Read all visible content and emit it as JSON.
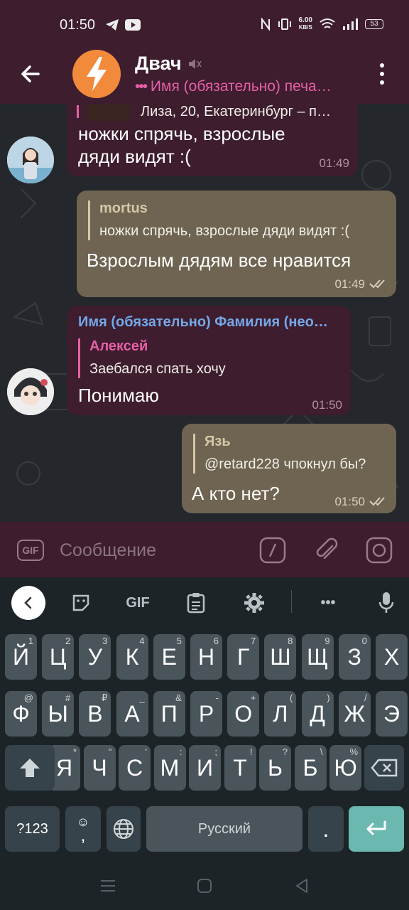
{
  "status_bar": {
    "time": "01:50",
    "speed_top": "6.00",
    "speed_unit": "KB/S",
    "battery": "53"
  },
  "header": {
    "back_label": "back",
    "title": "Двач",
    "subtitle": "Имя (обязательно) печа…",
    "typing_dots": "•••"
  },
  "messages": [
    {
      "direction": "in",
      "reply_text": "Лиза, 20, Екатеринбург – п…",
      "text_line1": "ножки спрячь, взрослые",
      "text_line2": "дяди видят :(",
      "time": "01:49"
    },
    {
      "direction": "out",
      "reply_name": "mortus",
      "reply_text": "ножки спрячь, взрослые дяди видят :(",
      "text": "Взрослым дядям все нравится",
      "time": "01:49"
    },
    {
      "direction": "in",
      "sender": "Имя (обязательно) Фамилия (нео…",
      "reply_name": "Алексей",
      "reply_text": "Заебался спать хочу",
      "text": "Понимаю",
      "time": "01:50"
    },
    {
      "direction": "out",
      "reply_name": "Язь",
      "reply_text": "@retard228 чпокнул бы?",
      "text": "А кто нет?",
      "time": "01:50"
    }
  ],
  "input": {
    "gif_label": "GIF",
    "placeholder": "Сообщение"
  },
  "keyboard": {
    "toolbar_gif": "GIF",
    "toolbar_more": "•••",
    "row1": [
      {
        "k": "Й",
        "h": "1"
      },
      {
        "k": "Ц",
        "h": "2"
      },
      {
        "k": "У",
        "h": "3"
      },
      {
        "k": "К",
        "h": "4"
      },
      {
        "k": "Е",
        "h": "5"
      },
      {
        "k": "Н",
        "h": "6"
      },
      {
        "k": "Г",
        "h": "7"
      },
      {
        "k": "Ш",
        "h": "8"
      },
      {
        "k": "Щ",
        "h": "9"
      },
      {
        "k": "З",
        "h": "0"
      },
      {
        "k": "Х",
        "h": ""
      }
    ],
    "row2": [
      {
        "k": "Ф",
        "h": "@"
      },
      {
        "k": "Ы",
        "h": "#"
      },
      {
        "k": "В",
        "h": "₽"
      },
      {
        "k": "А",
        "h": "_"
      },
      {
        "k": "П",
        "h": "&"
      },
      {
        "k": "Р",
        "h": "-"
      },
      {
        "k": "О",
        "h": "+"
      },
      {
        "k": "Л",
        "h": "("
      },
      {
        "k": "Д",
        "h": ")"
      },
      {
        "k": "Ж",
        "h": "/"
      },
      {
        "k": "Э",
        "h": ""
      }
    ],
    "row3": [
      {
        "k": "Я",
        "h": "*"
      },
      {
        "k": "Ч",
        "h": "\""
      },
      {
        "k": "С",
        "h": "'"
      },
      {
        "k": "М",
        "h": ":"
      },
      {
        "k": "И",
        "h": ";"
      },
      {
        "k": "Т",
        "h": "!"
      },
      {
        "k": "Ь",
        "h": "?"
      },
      {
        "k": "Б",
        "h": "\\"
      },
      {
        "k": "Ю",
        "h": "%"
      }
    ],
    "sym_label": "?123",
    "emoji_comma": ",",
    "emoji_glyph": "☺",
    "space_label": "Русский",
    "period_label": "."
  },
  "colors": {
    "header_bg": "#3d1d2e",
    "incoming_bubble": "#3d1d2e",
    "outgoing_bubble": "#6e6451",
    "accent_pink": "#e85fa8",
    "sender_blue": "#74a8e8",
    "reply_out": "#d6c8a6",
    "enter_key": "#6bb8b0"
  }
}
